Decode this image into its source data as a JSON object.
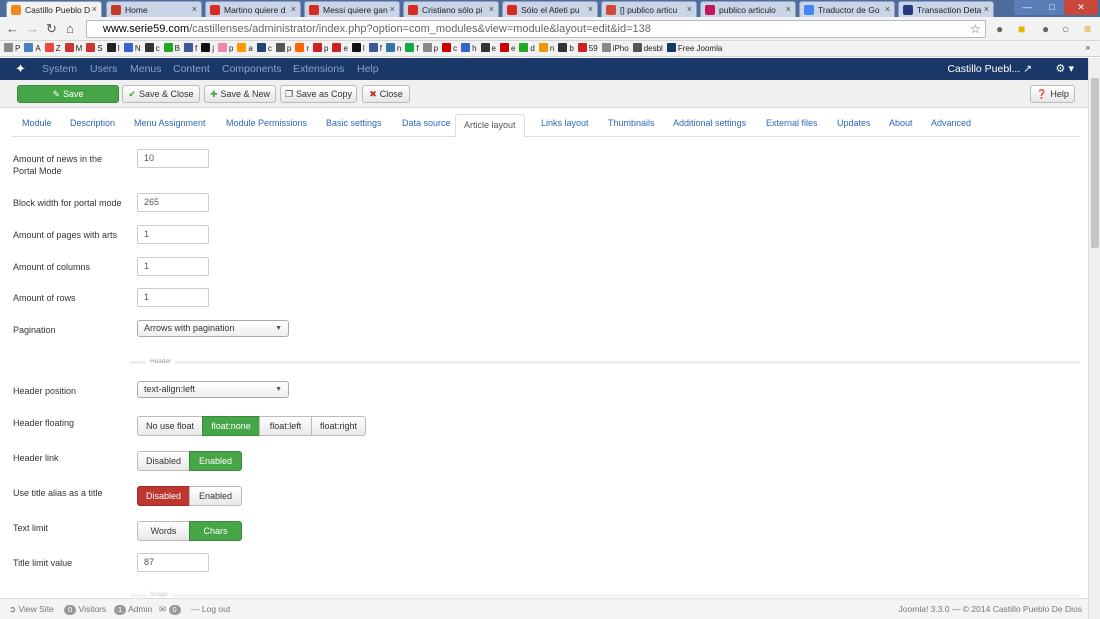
{
  "browser": {
    "tabs": [
      {
        "title": "Castillo Pueblo D",
        "color": "#f08a1c",
        "active": true
      },
      {
        "title": "Home",
        "color": "#c0392b"
      },
      {
        "title": "Martino quiere d",
        "color": "#d62d20"
      },
      {
        "title": "Messi quiere gan",
        "color": "#d62d20"
      },
      {
        "title": "Cristiano sólo pi",
        "color": "#d62d20"
      },
      {
        "title": "Sólo el Atleti pu",
        "color": "#d62d20"
      },
      {
        "title": "[] publico articu",
        "color": "#d44638"
      },
      {
        "title": "publico articulo",
        "color": "#c2185b"
      },
      {
        "title": "Traductor de Go",
        "color": "#4285f4"
      },
      {
        "title": "Transaction Deta",
        "color": "#253b80"
      }
    ],
    "url_host": "www.serie59.com",
    "url_path": "/castillenses/administrator/index.php?option=com_modules&view=module&layout=edit&id=138",
    "bookmarks": [
      {
        "label": "P",
        "color": "#888"
      },
      {
        "label": "A",
        "color": "#4a7fc1"
      },
      {
        "label": "Z",
        "color": "#e44"
      },
      {
        "label": "M",
        "color": "#c33"
      },
      {
        "label": "S",
        "color": "#c33"
      },
      {
        "label": "I",
        "color": "#222"
      },
      {
        "label": "N",
        "color": "#3366cc"
      },
      {
        "label": "c",
        "color": "#333"
      },
      {
        "label": "B",
        "color": "#2a2"
      },
      {
        "label": "f",
        "color": "#3b5998"
      },
      {
        "label": "j",
        "color": "#111"
      },
      {
        "label": "p",
        "color": "#e8a"
      },
      {
        "label": "a",
        "color": "#f90"
      },
      {
        "label": "c",
        "color": "#247"
      },
      {
        "label": "p",
        "color": "#555"
      },
      {
        "label": "r",
        "color": "#f60"
      },
      {
        "label": "p",
        "color": "#c22"
      },
      {
        "label": "e",
        "color": "#c22"
      },
      {
        "label": "l",
        "color": "#111"
      },
      {
        "label": "f",
        "color": "#3b5998"
      },
      {
        "label": "n",
        "color": "#37a"
      },
      {
        "label": "f",
        "color": "#1a4"
      },
      {
        "label": "p",
        "color": "#888"
      },
      {
        "label": "c",
        "color": "#c00"
      },
      {
        "label": "h",
        "color": "#36c"
      },
      {
        "label": "e",
        "color": "#333"
      },
      {
        "label": "e",
        "color": "#c00"
      },
      {
        "label": "d",
        "color": "#2a2"
      },
      {
        "label": "n",
        "color": "#e90"
      },
      {
        "label": "b",
        "color": "#333"
      },
      {
        "label": "59",
        "color": "#c22"
      },
      {
        "label": "iPho",
        "color": "#888"
      },
      {
        "label": "desbl",
        "color": "#555"
      },
      {
        "label": "Free Joomla",
        "color": "#1a3867"
      }
    ]
  },
  "joomla": {
    "menu": [
      "System",
      "Users",
      "Menus",
      "Content",
      "Components",
      "Extensions",
      "Help"
    ],
    "site_name": "Castillo Puebl...",
    "toolbar": {
      "save": "Save",
      "save_close": "Save & Close",
      "save_new": "Save & New",
      "save_copy": "Save as Copy",
      "close": "Close",
      "help": "Help"
    },
    "tabs": [
      "Module",
      "Description",
      "Menu Assignment",
      "Module Permissions",
      "Basic settings",
      "Data source",
      "Article layout",
      "Links layout",
      "Thumbnails",
      "Additional settings",
      "External files",
      "Updates",
      "About",
      "Advanced"
    ],
    "active_tab": "Article layout",
    "fields": {
      "news_portal": {
        "label_1": "Amount of news in the",
        "label_2": "Portal Mode",
        "value": "10"
      },
      "block_width": {
        "label": "Block width for portal mode",
        "value": "265"
      },
      "pages_arts": {
        "label": "Amount of pages with arts",
        "value": "1"
      },
      "columns": {
        "label": "Amount of columns",
        "value": "1"
      },
      "rows": {
        "label": "Amount of rows",
        "value": "1"
      },
      "pagination": {
        "label": "Pagination",
        "value": "Arrows with pagination"
      },
      "header_section": "Header",
      "header_position": {
        "label": "Header position",
        "value": "text-align:left"
      },
      "header_floating": {
        "label": "Header floating",
        "options": [
          "No use float",
          "float:none",
          "float:left",
          "float:right"
        ],
        "selected": "float:none"
      },
      "header_link": {
        "label": "Header link",
        "options": [
          "Disabled",
          "Enabled"
        ],
        "selected": "Enabled"
      },
      "title_alias": {
        "label": "Use title alias as a title",
        "options": [
          "Disabled",
          "Enabled"
        ],
        "selected": "Disabled"
      },
      "text_limit": {
        "label": "Text limit",
        "options": [
          "Words",
          "Chars"
        ],
        "selected": "Chars"
      },
      "title_limit": {
        "label": "Title limit value",
        "value": "87"
      },
      "image_section": "Image"
    },
    "status": {
      "view_site": "View Site",
      "visitors_count": "0",
      "visitors": "Visitors",
      "admin_count": "1",
      "admin": "Admin",
      "msg_count": "0",
      "logout": "Log out",
      "version": "Joomla! 3.3.0 — © 2014 Castillo Pueblo De Dios"
    }
  },
  "colors": {
    "nav_bg": "#1a3867",
    "green": "#46a546",
    "red": "#bd362f",
    "link": "#2a69b8"
  }
}
